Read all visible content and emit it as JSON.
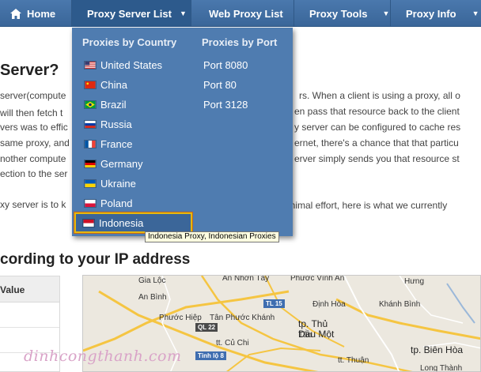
{
  "nav": {
    "home": "Home",
    "proxy_server_list": "Proxy Server List",
    "web_proxy_list": "Web Proxy List",
    "proxy_tools": "Proxy Tools",
    "proxy_info": "Proxy Info"
  },
  "page": {
    "heading": "Server?",
    "lines": [
      "server(compute",
      "will then fetch t",
      "vers was to effic",
      "same proxy, and",
      "nother compute",
      "ection to the ser",
      "xy server is to k",
      "rs. When a client is using a proxy, all o",
      "en pass that resource back to the client",
      "y server can be configured to cache res",
      "ernet, there's a chance that that particu",
      "erver simply sends you that resource st",
      "inimal effort, here is what we currently"
    ],
    "heading2": "cording to your IP address",
    "table_header": "Value"
  },
  "dropdown": {
    "country_title": "Proxies by Country",
    "port_title": "Proxies by Port",
    "countries": [
      "United States",
      "China",
      "Brazil",
      "Russia",
      "France",
      "Germany",
      "Ukraine",
      "Poland",
      "Indonesia"
    ],
    "ports": [
      "Port 8080",
      "Port 80",
      "Port 3128"
    ],
    "selected": "Indonesia"
  },
  "tooltip": "Indonesia Proxy, Indonesian Proxies",
  "map": {
    "labels": [
      "Gia Lộc",
      "An Nhơn Tây",
      "Phước Vĩnh An",
      "Hưng",
      "An Bình",
      "Định Hòa",
      "Khánh Bình",
      "Phước Hiệp",
      "Tân Phước Khánh",
      "tt. Củ Chi",
      "Tân",
      "tt. Thuận",
      "Long Thành"
    ],
    "shields": [
      "TL 15",
      "QL 22",
      "Tỉnh lộ 8"
    ],
    "cities": [
      {
        "name": "tp. Thủ",
        "line2": "Dầu Một"
      },
      {
        "name": "tp. Biên Hòa",
        "line2": ""
      }
    ]
  },
  "watermark": "dinhcongthanh.com",
  "colors": {
    "nav": "#3a6699",
    "dropdown": "#4f7cb0",
    "highlight_border": "#e6b80e",
    "tooltip_bg": "#ffffe1"
  }
}
